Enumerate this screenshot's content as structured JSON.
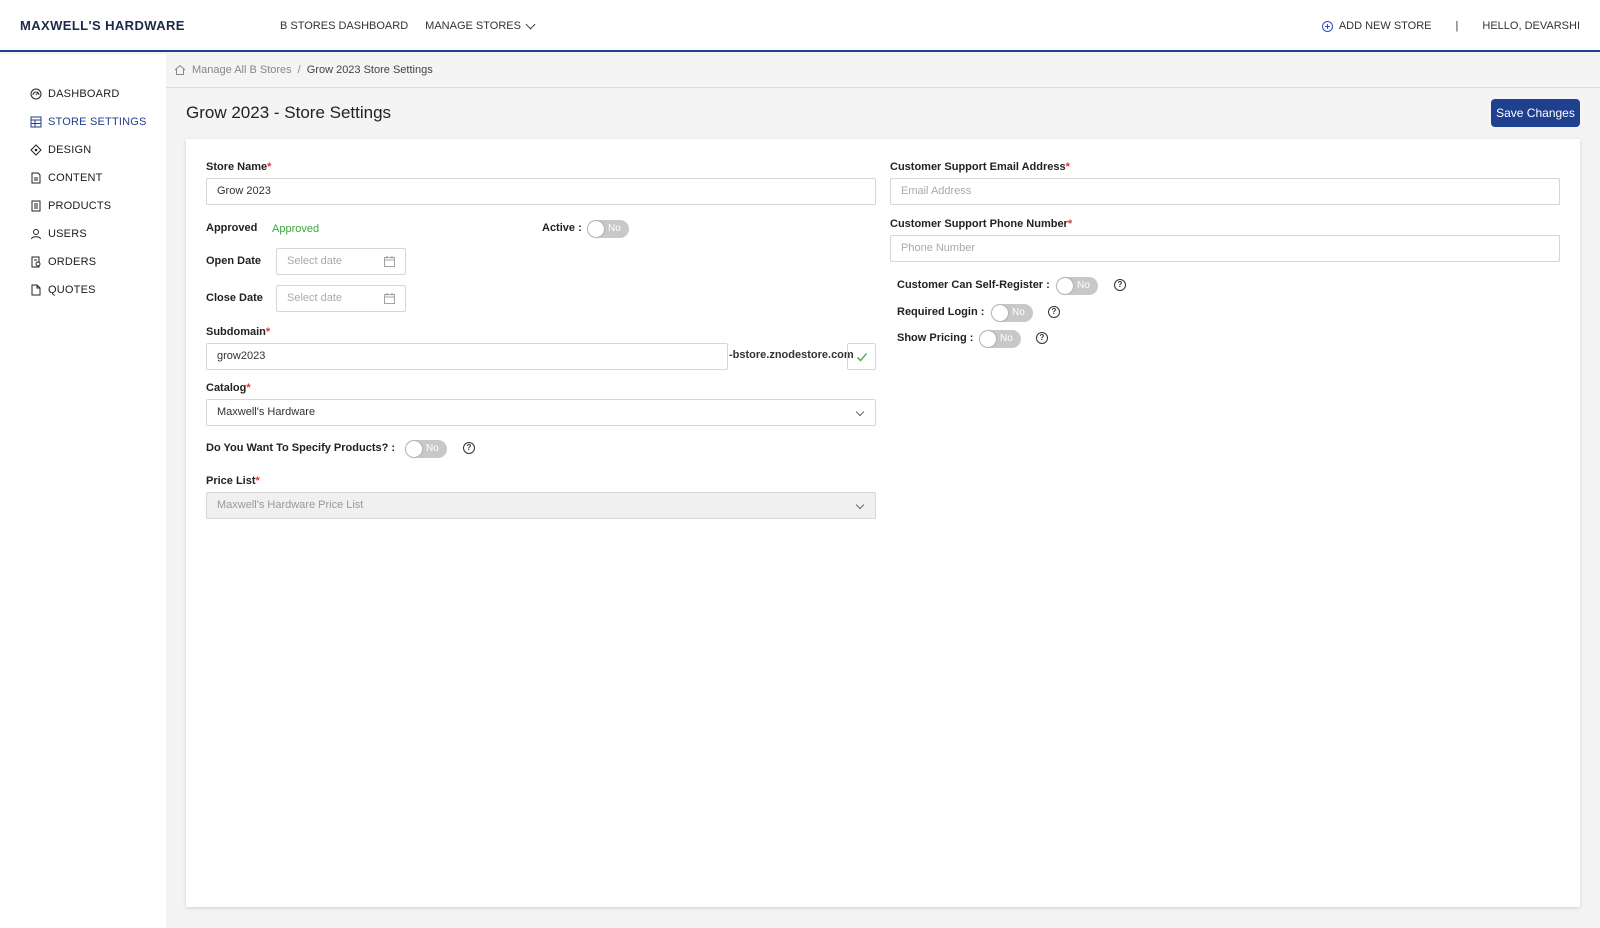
{
  "header": {
    "brand": "MAXWELL'S HARDWARE",
    "nav": [
      "B STORES DASHBOARD",
      "MANAGE STORES"
    ],
    "add_new_store": "ADD NEW STORE",
    "separator": "|",
    "greeting": "HELLO, DEVARSHI"
  },
  "sidebar": {
    "items": [
      {
        "label": "DASHBOARD",
        "icon": "gauge-icon"
      },
      {
        "label": "STORE SETTINGS",
        "icon": "table-icon",
        "active": true
      },
      {
        "label": "DESIGN",
        "icon": "diamond-icon"
      },
      {
        "label": "CONTENT",
        "icon": "document-icon"
      },
      {
        "label": "PRODUCTS",
        "icon": "list-icon"
      },
      {
        "label": "USERS",
        "icon": "user-icon"
      },
      {
        "label": "ORDERS",
        "icon": "receipt-icon"
      },
      {
        "label": "QUOTES",
        "icon": "file-icon"
      }
    ]
  },
  "breadcrumb": {
    "parent": "Manage All B Stores",
    "separator": "/",
    "current": "Grow 2023 Store Settings"
  },
  "page": {
    "title": "Grow 2023 - Store Settings",
    "save_label": "Save Changes"
  },
  "form": {
    "store_name": {
      "label": "Store Name",
      "required": "*",
      "value": "Grow 2023"
    },
    "approved": {
      "label": "Approved",
      "value": "Approved",
      "value_color": "#3aa63a"
    },
    "active": {
      "label": "Active",
      "colon": ":",
      "toggle": "No"
    },
    "open_date": {
      "label": "Open Date",
      "placeholder": "Select date"
    },
    "close_date": {
      "label": "Close Date",
      "placeholder": "Select date"
    },
    "subdomain": {
      "label": "Subdomain",
      "required": "*",
      "value": "grow2023",
      "suffix": "-bstore.znodestore.com"
    },
    "catalog": {
      "label": "Catalog",
      "required": "*",
      "value": "Maxwell's Hardware"
    },
    "specify_products": {
      "label": "Do You Want To Specify Products?",
      "colon": ":",
      "toggle": "No"
    },
    "price_list": {
      "label": "Price List",
      "required": "*",
      "value": "Maxwell's Hardware Price List"
    },
    "support_email": {
      "label": "Customer Support Email Address",
      "required": "*",
      "placeholder": "Email Address"
    },
    "support_phone": {
      "label": "Customer Support Phone Number",
      "required": "*",
      "placeholder": "Phone Number"
    },
    "self_register": {
      "label": "Customer Can Self-Register",
      "colon": ":",
      "toggle": "No"
    },
    "required_login": {
      "label": "Required Login",
      "colon": ":",
      "toggle": "No"
    },
    "show_pricing": {
      "label": "Show Pricing",
      "colon": ":",
      "toggle": "No"
    },
    "help_glyph": "?"
  },
  "colors": {
    "accent": "#1f3f8f",
    "required": "#d33333",
    "approved": "#3aa63a"
  }
}
